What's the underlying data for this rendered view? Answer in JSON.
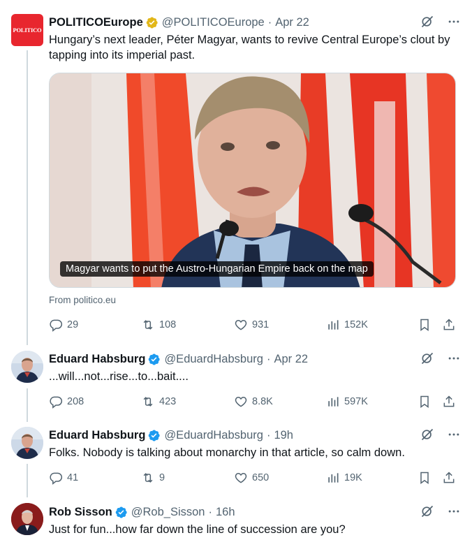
{
  "tweets": [
    {
      "name": "POLITICOEurope",
      "handle": "@POLITICOEurope",
      "sep": "·",
      "time": "Apr 22",
      "badge": "gold",
      "avatar_label": "POLITICO",
      "text": "Hungary’s next leader, Péter Magyar, wants to revive Central Europe’s clout by tapping into its imperial past.",
      "media_caption": "Magyar wants to put the Austro-Hungarian Empire back on the map",
      "from": "From politico.eu",
      "stats": {
        "replies": "29",
        "reposts": "108",
        "likes": "931",
        "views": "152K"
      }
    },
    {
      "name": "Eduard Habsburg",
      "handle": "@EduardHabsburg",
      "sep": "·",
      "time": "Apr 22",
      "badge": "blue",
      "text": "...will...not...rise...to...bait....",
      "stats": {
        "replies": "208",
        "reposts": "423",
        "likes": "8.8K",
        "views": "597K"
      }
    },
    {
      "name": "Eduard Habsburg",
      "handle": "@EduardHabsburg",
      "sep": "·",
      "time": "19h",
      "badge": "blue",
      "text": "Folks. Nobody is talking about monarchy in that article, so calm down.",
      "stats": {
        "replies": "41",
        "reposts": "9",
        "likes": "650",
        "views": "19K"
      }
    },
    {
      "name": "Rob Sisson",
      "handle": "@Rob_Sisson",
      "sep": "·",
      "time": "16h",
      "badge": "blue",
      "text": "Just for fun...how far down the line of succession are you?"
    }
  ],
  "colors": {
    "politico_red": "#e8262e",
    "verified_blue": "#1d9bf0",
    "gold": "#e2b719",
    "muted": "#536471"
  }
}
